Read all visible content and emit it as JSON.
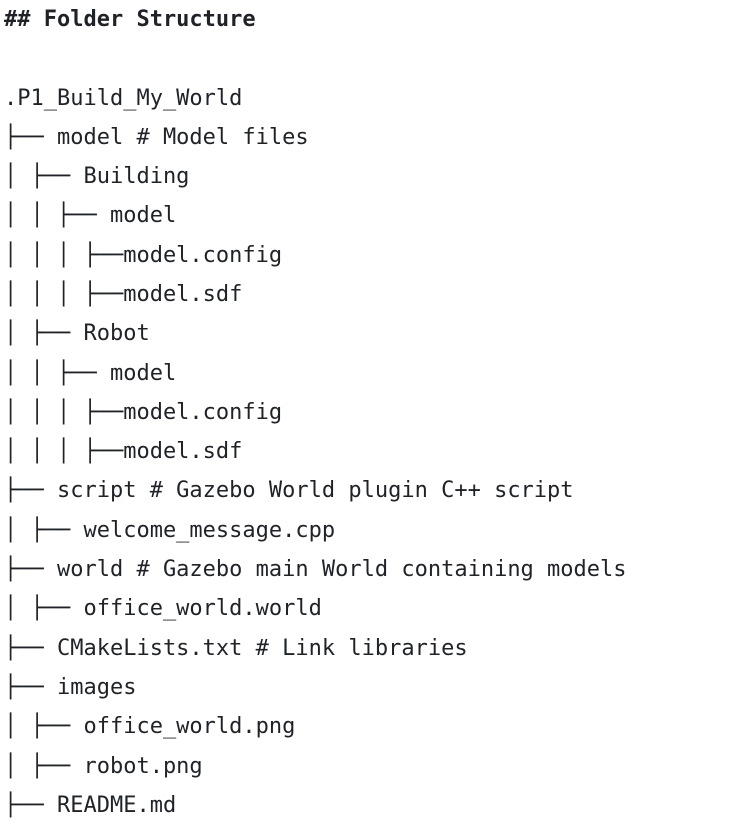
{
  "heading": "## Folder Structure",
  "lines": [
    ".P1_Build_My_World",
    "├── model # Model files",
    "│ ├── Building",
    "│ │ ├── model",
    "│ │ │ ├──model.config",
    "│ │ │ ├──model.sdf",
    "│ ├── Robot",
    "│ │ ├── model",
    "│ │ │ ├──model.config",
    "│ │ │ ├──model.sdf",
    "├── script # Gazebo World plugin C++ script",
    "│ ├── welcome_message.cpp",
    "├── world # Gazebo main World containing models",
    "│ ├── office_world.world",
    "├── CMakeLists.txt # Link libraries",
    "├── images",
    "│ ├── office_world.png",
    "│ ├── robot.png",
    "├── README.md"
  ]
}
